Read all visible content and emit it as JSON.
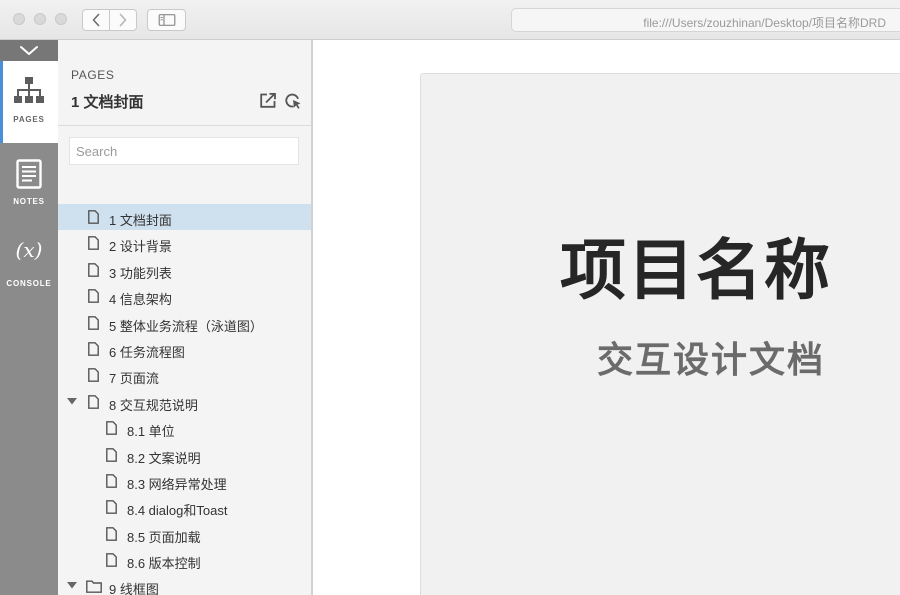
{
  "browser": {
    "url": "file:///Users/zouzhinan/Desktop/项目名称DRD"
  },
  "rail": {
    "tabs": [
      {
        "label": "PAGES",
        "icon": "sitemap-icon",
        "active": true
      },
      {
        "label": "NOTES",
        "icon": "notes-icon",
        "active": false
      },
      {
        "label": "CONSOLE",
        "icon": "variable-icon",
        "symbol": "(x)",
        "active": false
      }
    ],
    "accent": "#4a90d9"
  },
  "panel": {
    "section_label": "PAGES",
    "current_page": "1 文档封面",
    "search_placeholder": "Search",
    "tree": [
      {
        "label": "1 文档封面",
        "level": 0,
        "icon": "page-icon",
        "selected": true
      },
      {
        "label": "2 设计背景",
        "level": 0,
        "icon": "page-icon"
      },
      {
        "label": "3 功能列表",
        "level": 0,
        "icon": "page-icon"
      },
      {
        "label": "4 信息架构",
        "level": 0,
        "icon": "page-icon"
      },
      {
        "label": "5 整体业务流程（泳道图）",
        "level": 0,
        "icon": "page-icon"
      },
      {
        "label": "6 任务流程图",
        "level": 0,
        "icon": "page-icon"
      },
      {
        "label": "7 页面流",
        "level": 0,
        "icon": "page-icon"
      },
      {
        "label": "8 交互规范说明",
        "level": 0,
        "icon": "page-icon",
        "expanded": true
      },
      {
        "label": "8.1 单位",
        "level": 1,
        "icon": "page-icon"
      },
      {
        "label": "8.2 文案说明",
        "level": 1,
        "icon": "page-icon"
      },
      {
        "label": "8.3 网络异常处理",
        "level": 1,
        "icon": "page-icon"
      },
      {
        "label": "8.4 dialog和Toast",
        "level": 1,
        "icon": "page-icon"
      },
      {
        "label": "8.5 页面加载",
        "level": 1,
        "icon": "page-icon"
      },
      {
        "label": "8.6 版本控制",
        "level": 1,
        "icon": "page-icon"
      },
      {
        "label": "9 线框图",
        "level": 0,
        "icon": "folder-icon",
        "expanded": true
      }
    ],
    "selected_color": "#cfe0ef"
  },
  "document": {
    "title": "项目名称",
    "subtitle": "交互设计文档"
  }
}
